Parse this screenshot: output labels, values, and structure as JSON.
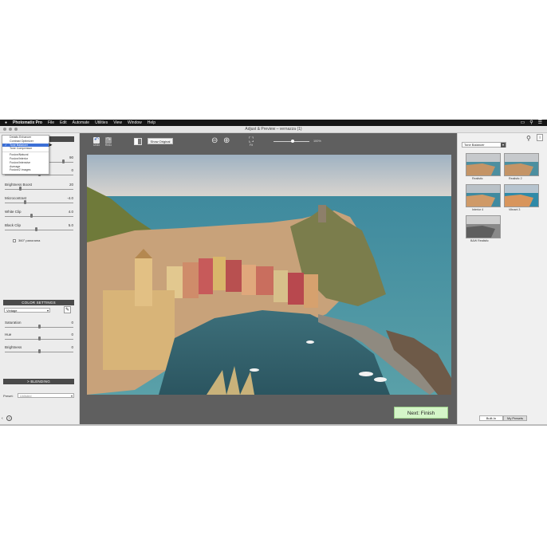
{
  "menubar": {
    "apple": "",
    "app": "Photomatix Pro",
    "items": [
      "File",
      "Edit",
      "Automate",
      "Utilities",
      "View",
      "Window",
      "Help"
    ],
    "right_icons": [
      "display-icon",
      "search-icon",
      "list-icon"
    ]
  },
  "window": {
    "title": "Adjust & Preview – vernazza (1)"
  },
  "left": {
    "method_menu": {
      "items": [
        "Details Enhancer",
        "Contrast Optimizer",
        "Tone Balancer",
        "Tone Compressor",
        "Fusion/Natural",
        "Fusion/Interior",
        "Fusion/Intensive",
        "Average",
        "Fusion/2 images"
      ],
      "selected_index": 2
    },
    "sliders": [
      {
        "label": "",
        "value": "90"
      },
      {
        "label": "",
        "value": "0"
      },
      {
        "label": "Brightness Boost",
        "value": "20"
      },
      {
        "label": "Microcontrast",
        "value": "-4.0"
      },
      {
        "label": "White Clip",
        "value": "4.0"
      },
      {
        "label": "Black Clip",
        "value": "5.0"
      }
    ],
    "panorama_label": "360° panorama",
    "color_settings": {
      "header": "COLOR SETTINGS",
      "select_value": "Vintage",
      "sliders": [
        {
          "label": "Saturation",
          "value": "0"
        },
        {
          "label": "Hue",
          "value": "0"
        },
        {
          "label": "Brightness",
          "value": "0"
        }
      ]
    },
    "blending": {
      "header": "> BLENDING"
    },
    "preset": {
      "label": "Preset:",
      "value": "Unlisted"
    }
  },
  "toolbar": {
    "undo": "Undo",
    "redo": "Redo",
    "show_original": "Show Original",
    "fit": "Fit",
    "zoom": "100%"
  },
  "next_finish": "Next: Finish",
  "right": {
    "preset_select": "Tone Balancer",
    "thumbs": [
      "Realistic",
      "Realistic 2",
      "Interior 4",
      "Vibrant 3",
      "B&W Realistic"
    ],
    "tabs": [
      "Built-In",
      "My Presets"
    ]
  },
  "colors": {
    "center_bg": "#5f5f5f",
    "panel_bg": "#ececec",
    "menu_select": "#3b6fd6",
    "finish_bg": "#d4f5c8"
  }
}
